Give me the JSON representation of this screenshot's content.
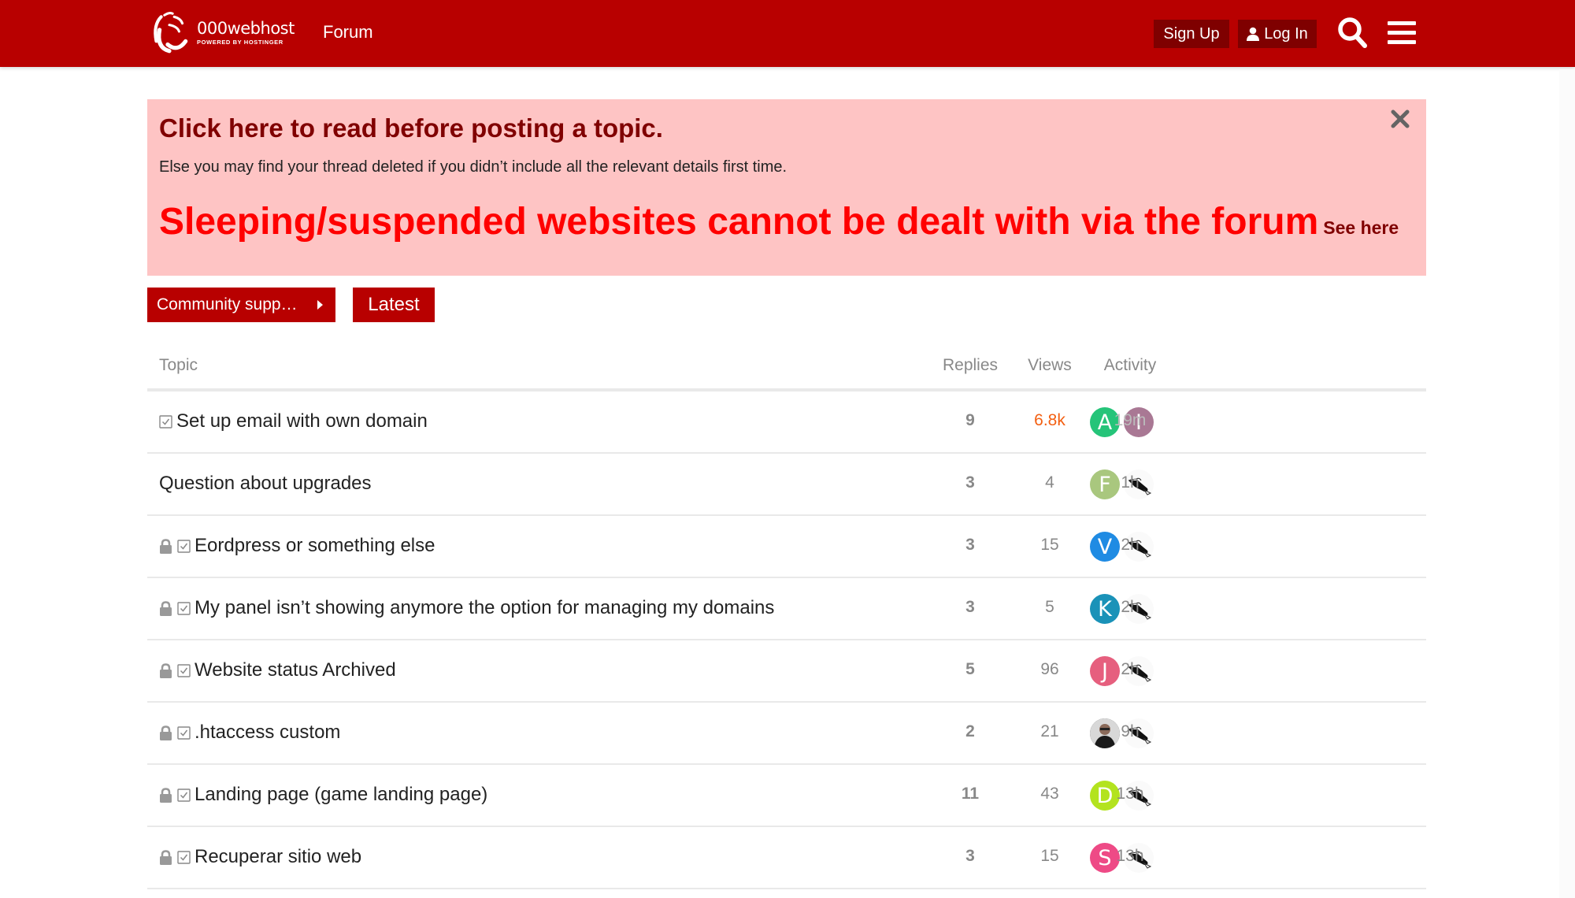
{
  "header": {
    "logo_name": "000webhost",
    "logo_sub": "POWERED BY HOSTINGER",
    "forum_label": "Forum",
    "signup_label": "Sign Up",
    "login_label": "Log In",
    "brand_color": "#b80000"
  },
  "banner": {
    "title": "Click here to read before posting a topic.",
    "subtitle": "Else you may find your thread deleted if you didn’t include all the relevant details first time.",
    "headline": "Sleeping/suspended websites cannot be dealt with via the forum",
    "see_here": "See here"
  },
  "nav": {
    "category_label": "Community supp…",
    "latest_label": "Latest"
  },
  "table": {
    "headers": {
      "topic": "Topic",
      "replies": "Replies",
      "views": "Views",
      "activity": "Activity"
    },
    "rows": [
      {
        "title": "Set up email with own domain",
        "locked": false,
        "solved": true,
        "posters": [
          {
            "letter": "A",
            "color": "#25c479"
          },
          {
            "letter": "I",
            "color": "#a97894"
          }
        ],
        "replies": "9",
        "views": "6.8k",
        "views_hot": true,
        "activity": "19m",
        "fresh": true
      },
      {
        "title": "Question about upgrades",
        "locked": false,
        "solved": false,
        "posters": [
          {
            "letter": "F",
            "color": "#a9c77e"
          },
          {
            "letter": "bird",
            "color": ""
          }
        ],
        "replies": "3",
        "views": "4",
        "views_hot": false,
        "activity": "1h",
        "fresh": false
      },
      {
        "title": "Eordpress or something else",
        "locked": true,
        "solved": true,
        "posters": [
          {
            "letter": "V",
            "color": "#1f8be3"
          },
          {
            "letter": "bird",
            "color": ""
          }
        ],
        "replies": "3",
        "views": "15",
        "views_hot": false,
        "activity": "2h",
        "fresh": false
      },
      {
        "title": "My panel isn’t showing anymore the option for managing my domains",
        "locked": true,
        "solved": true,
        "posters": [
          {
            "letter": "K",
            "color": "#1a92b8"
          },
          {
            "letter": "bird",
            "color": ""
          }
        ],
        "replies": "3",
        "views": "5",
        "views_hot": false,
        "activity": "2h",
        "fresh": false
      },
      {
        "title": "Website status Archived",
        "locked": true,
        "solved": true,
        "posters": [
          {
            "letter": "J",
            "color": "#e65f7e"
          },
          {
            "letter": "bird",
            "color": ""
          }
        ],
        "replies": "5",
        "views": "96",
        "views_hot": false,
        "activity": "2h",
        "fresh": false
      },
      {
        "title": ".htaccess custom",
        "locked": true,
        "solved": true,
        "posters": [
          {
            "letter": "photo",
            "color": ""
          },
          {
            "letter": "bird",
            "color": ""
          }
        ],
        "replies": "2",
        "views": "21",
        "views_hot": false,
        "activity": "9h",
        "fresh": false
      },
      {
        "title": "Landing page (game landing page)",
        "locked": true,
        "solved": true,
        "posters": [
          {
            "letter": "D",
            "color": "#b3e31f"
          },
          {
            "letter": "bird",
            "color": ""
          }
        ],
        "replies": "11",
        "views": "43",
        "views_hot": false,
        "activity": "13h",
        "fresh": false
      },
      {
        "title": "Recuperar sitio web",
        "locked": true,
        "solved": true,
        "posters": [
          {
            "letter": "S",
            "color": "#ee4a86"
          },
          {
            "letter": "bird",
            "color": ""
          }
        ],
        "replies": "3",
        "views": "15",
        "views_hot": false,
        "activity": "13h",
        "fresh": false
      }
    ]
  },
  "colors": {
    "hot_views": "#f35f11",
    "banner_bg": "#fec4c4",
    "banner_red": "#ff0000"
  }
}
